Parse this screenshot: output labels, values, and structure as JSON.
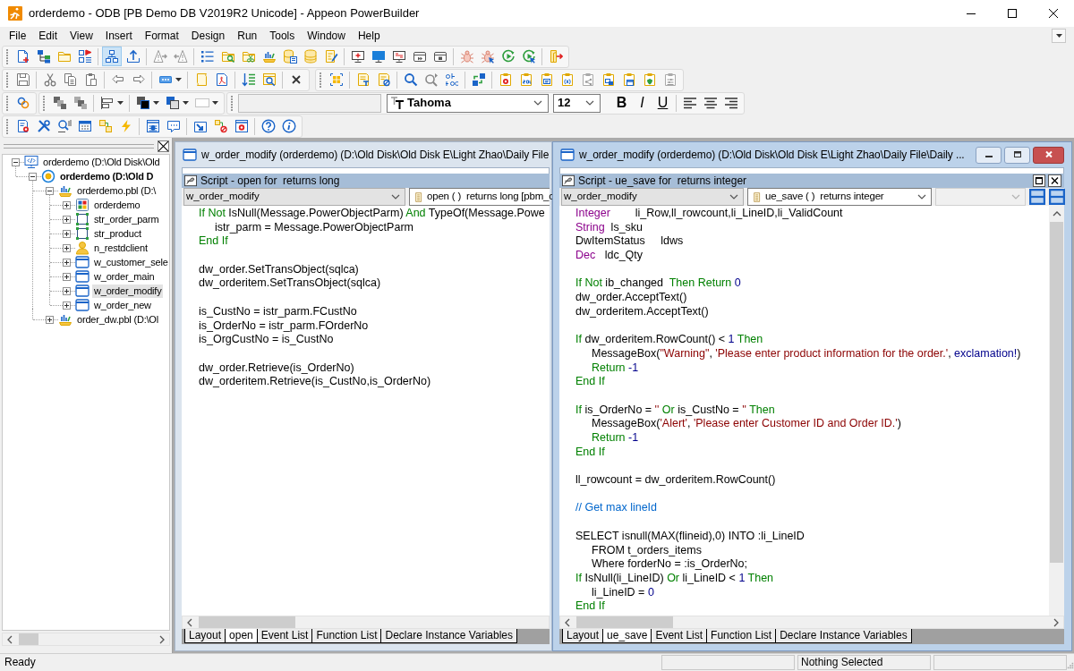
{
  "window": {
    "title": "orderdemo - ODB [PB Demo DB V2019R2 Unicode]  - Appeon PowerBuilder"
  },
  "menu": [
    "File",
    "Edit",
    "View",
    "Insert",
    "Format",
    "Design",
    "Run",
    "Tools",
    "Window",
    "Help"
  ],
  "toolbar": {
    "structure_button": {
      "selected": true
    },
    "font_name": "Tahoma",
    "font_size": "12",
    "style_buttons": [
      {
        "kind": "bold",
        "label": "B"
      },
      {
        "kind": "italic",
        "label": "I"
      },
      {
        "kind": "underline",
        "label": "U"
      }
    ]
  },
  "tree": [
    {
      "kind": "workspace",
      "label": "orderdemo (D:\\Old Disk\\Old",
      "expanded": true,
      "selected": false,
      "children": [
        {
          "kind": "target",
          "label": "orderdemo (D:\\Old D",
          "expanded": true,
          "selected": false,
          "children": [
            {
              "kind": "library",
              "label": "orderdemo.pbl (D:\\",
              "expanded": true,
              "selected": false,
              "children": [
                {
                  "kind": "application",
                  "label": "orderdemo",
                  "expanded": false,
                  "selected": false
                },
                {
                  "kind": "structure",
                  "label": "str_order_parm",
                  "expanded": false,
                  "selected": false
                },
                {
                  "kind": "structure",
                  "label": "str_product",
                  "expanded": false,
                  "selected": false
                },
                {
                  "kind": "userobject",
                  "label": "n_restdclient",
                  "expanded": false,
                  "selected": false
                },
                {
                  "kind": "window",
                  "label": "w_customer_sele",
                  "expanded": false,
                  "selected": false
                },
                {
                  "kind": "window",
                  "label": "w_order_main",
                  "expanded": false,
                  "selected": false
                },
                {
                  "kind": "window",
                  "label": "w_order_modify",
                  "expanded": false,
                  "selected": true
                },
                {
                  "kind": "window",
                  "label": "w_order_new",
                  "expanded": false,
                  "selected": false
                }
              ]
            },
            {
              "kind": "library",
              "label": "order_dw.pbl (D:\\Ol",
              "expanded": false,
              "selected": false
            }
          ]
        }
      ]
    }
  ],
  "editors": [
    {
      "title": "w_order_modify (orderdemo) (D:\\Old Disk\\Old Disk E\\Light Zhao\\Daily File",
      "active": false,
      "vertical_scrollbar": false,
      "pane_controls": false,
      "script_title": "Script - open for  returns long",
      "object_dropdown": "w_order_modify",
      "event_dropdown": "open ( )  returns long [pbm_o",
      "code": [
        {
          "kind": "code",
          "indented": false,
          "segments": [
            {
              "kind": "keyword",
              "text": "If Not"
            },
            {
              "kind": "plain",
              "text": " IsNull(Message.PowerObjectParm) "
            },
            {
              "kind": "keyword",
              "text": "And"
            },
            {
              "kind": "plain",
              "text": " TypeOf(Message.Powe"
            }
          ]
        },
        {
          "kind": "code",
          "indented": true,
          "segments": [
            {
              "kind": "plain",
              "text": "istr_parm = Message.PowerObjectParm"
            }
          ]
        },
        {
          "kind": "code",
          "indented": false,
          "segments": [
            {
              "kind": "keyword",
              "text": "End If"
            }
          ]
        },
        {
          "kind": "blank"
        },
        {
          "kind": "code",
          "indented": false,
          "segments": [
            {
              "kind": "plain",
              "text": "dw_order.SetTransObject(sqlca)"
            }
          ]
        },
        {
          "kind": "code",
          "indented": false,
          "segments": [
            {
              "kind": "plain",
              "text": "dw_orderitem.SetTransObject(sqlca)"
            }
          ]
        },
        {
          "kind": "blank"
        },
        {
          "kind": "code",
          "indented": false,
          "segments": [
            {
              "kind": "plain",
              "text": "is_CustNo = istr_parm.FCustNo"
            }
          ]
        },
        {
          "kind": "code",
          "indented": false,
          "segments": [
            {
              "kind": "plain",
              "text": "is_OrderNo = istr_parm.FOrderNo"
            }
          ]
        },
        {
          "kind": "code",
          "indented": false,
          "segments": [
            {
              "kind": "plain",
              "text": "is_OrgCustNo = is_CustNo"
            }
          ]
        },
        {
          "kind": "blank"
        },
        {
          "kind": "code",
          "indented": false,
          "segments": [
            {
              "kind": "plain",
              "text": "dw_order.Retrieve(is_OrderNo)"
            }
          ]
        },
        {
          "kind": "code",
          "indented": false,
          "segments": [
            {
              "kind": "plain",
              "text": "dw_orderitem.Retrieve(is_CustNo,is_OrderNo)"
            }
          ]
        }
      ],
      "tabs": [
        {
          "label": "Layout",
          "selected": false
        },
        {
          "label": "open",
          "selected": true
        },
        {
          "label": "Event List",
          "selected": false
        },
        {
          "label": "Function List",
          "selected": false
        },
        {
          "label": "Declare Instance Variables",
          "selected": false
        }
      ]
    },
    {
      "title": "w_order_modify (orderdemo) (D:\\Old Disk\\Old Disk E\\Light Zhao\\Daily File\\Daily ...",
      "active": true,
      "vertical_scrollbar": true,
      "pane_controls": true,
      "script_title": "Script - ue_save for  returns integer",
      "object_dropdown": "w_order_modify",
      "event_dropdown": "ue_save ( )  returns integer",
      "dropdown_3": {
        "disabled": true
      },
      "code": [
        {
          "kind": "code",
          "indented": false,
          "segments": [
            {
              "kind": "type",
              "text": "Integer"
            },
            {
              "kind": "plain",
              "text": "        li_Row,ll_rowcount,li_LineID,li_ValidCount"
            }
          ]
        },
        {
          "kind": "code",
          "indented": false,
          "segments": [
            {
              "kind": "type",
              "text": "String"
            },
            {
              "kind": "plain",
              "text": "  ls_sku"
            }
          ]
        },
        {
          "kind": "code",
          "indented": false,
          "segments": [
            {
              "kind": "plain",
              "text": "DwItemStatus     ldws"
            }
          ]
        },
        {
          "kind": "code",
          "indented": false,
          "segments": [
            {
              "kind": "type",
              "text": "Dec"
            },
            {
              "kind": "plain",
              "text": "   ldc_Qty"
            }
          ]
        },
        {
          "kind": "blank"
        },
        {
          "kind": "code",
          "indented": false,
          "segments": [
            {
              "kind": "keyword",
              "text": "If Not"
            },
            {
              "kind": "plain",
              "text": " ib_changed  "
            },
            {
              "kind": "keyword",
              "text": "Then Return"
            },
            {
              "kind": "number",
              "text": " 0"
            }
          ]
        },
        {
          "kind": "code",
          "indented": false,
          "segments": [
            {
              "kind": "plain",
              "text": "dw_order.AcceptText()"
            }
          ]
        },
        {
          "kind": "code",
          "indented": false,
          "segments": [
            {
              "kind": "plain",
              "text": "dw_orderitem.AcceptText()"
            }
          ]
        },
        {
          "kind": "blank"
        },
        {
          "kind": "code",
          "indented": false,
          "segments": [
            {
              "kind": "keyword",
              "text": "If"
            },
            {
              "kind": "plain",
              "text": " dw_orderitem.RowCount() < "
            },
            {
              "kind": "number",
              "text": "1"
            },
            {
              "kind": "keyword",
              "text": " Then"
            }
          ]
        },
        {
          "kind": "code",
          "indented": true,
          "segments": [
            {
              "kind": "plain",
              "text": "MessageBox("
            },
            {
              "kind": "string",
              "text": "\"Warning\""
            },
            {
              "kind": "plain",
              "text": ", "
            },
            {
              "kind": "string",
              "text": "'Please enter product information for the order.'"
            },
            {
              "kind": "plain",
              "text": ", "
            },
            {
              "kind": "constant",
              "text": "exclamation!"
            },
            {
              "kind": "plain",
              "text": ")"
            }
          ]
        },
        {
          "kind": "code",
          "indented": true,
          "segments": [
            {
              "kind": "keyword",
              "text": "Return"
            },
            {
              "kind": "number",
              "text": " -1"
            }
          ]
        },
        {
          "kind": "code",
          "indented": false,
          "segments": [
            {
              "kind": "keyword",
              "text": "End If"
            }
          ]
        },
        {
          "kind": "blank"
        },
        {
          "kind": "code",
          "indented": false,
          "segments": [
            {
              "kind": "keyword",
              "text": "If"
            },
            {
              "kind": "plain",
              "text": " is_OrderNo = "
            },
            {
              "kind": "string",
              "text": "''"
            },
            {
              "kind": "keyword",
              "text": " Or"
            },
            {
              "kind": "plain",
              "text": " is_CustNo = "
            },
            {
              "kind": "string",
              "text": "''"
            },
            {
              "kind": "keyword",
              "text": " Then"
            }
          ]
        },
        {
          "kind": "code",
          "indented": true,
          "segments": [
            {
              "kind": "plain",
              "text": "MessageBox("
            },
            {
              "kind": "string",
              "text": "'Alert'"
            },
            {
              "kind": "plain",
              "text": ", "
            },
            {
              "kind": "string",
              "text": "'Please enter Customer ID and Order ID.'"
            },
            {
              "kind": "plain",
              "text": ")"
            }
          ]
        },
        {
          "kind": "code",
          "indented": true,
          "segments": [
            {
              "kind": "keyword",
              "text": "Return"
            },
            {
              "kind": "number",
              "text": " -1"
            }
          ]
        },
        {
          "kind": "code",
          "indented": false,
          "segments": [
            {
              "kind": "keyword",
              "text": "End If"
            }
          ]
        },
        {
          "kind": "blank"
        },
        {
          "kind": "code",
          "indented": false,
          "segments": [
            {
              "kind": "plain",
              "text": "ll_rowcount = dw_orderitem.RowCount()"
            }
          ]
        },
        {
          "kind": "blank"
        },
        {
          "kind": "code",
          "indented": false,
          "segments": [
            {
              "kind": "comment",
              "text": "// Get max lineId"
            }
          ]
        },
        {
          "kind": "blank"
        },
        {
          "kind": "code",
          "indented": false,
          "segments": [
            {
              "kind": "plain",
              "text": "SELECT isnull(MAX(flineid),0) INTO :li_LineID"
            }
          ]
        },
        {
          "kind": "code",
          "indented": true,
          "segments": [
            {
              "kind": "plain",
              "text": "FROM t_orders_items"
            }
          ]
        },
        {
          "kind": "code",
          "indented": true,
          "segments": [
            {
              "kind": "plain",
              "text": "Where forderNo = :is_OrderNo;"
            }
          ]
        },
        {
          "kind": "code",
          "indented": false,
          "segments": [
            {
              "kind": "keyword",
              "text": "If"
            },
            {
              "kind": "plain",
              "text": " IsNull(li_LineID) "
            },
            {
              "kind": "keyword",
              "text": "Or"
            },
            {
              "kind": "plain",
              "text": " li_LineID < "
            },
            {
              "kind": "number",
              "text": "1"
            },
            {
              "kind": "keyword",
              "text": " Then"
            }
          ]
        },
        {
          "kind": "code",
          "indented": true,
          "segments": [
            {
              "kind": "plain",
              "text": "li_LineID = "
            },
            {
              "kind": "number",
              "text": "0"
            }
          ]
        },
        {
          "kind": "code",
          "indented": false,
          "segments": [
            {
              "kind": "keyword",
              "text": "End If"
            }
          ]
        }
      ],
      "tabs": [
        {
          "label": "Layout",
          "selected": false
        },
        {
          "label": "ue_save",
          "selected": true
        },
        {
          "label": "Event List",
          "selected": false
        },
        {
          "label": "Function List",
          "selected": false
        },
        {
          "label": "Declare Instance Variables",
          "selected": false
        }
      ]
    }
  ],
  "status_bar": {
    "message": "Ready",
    "selection": "Nothing Selected"
  }
}
